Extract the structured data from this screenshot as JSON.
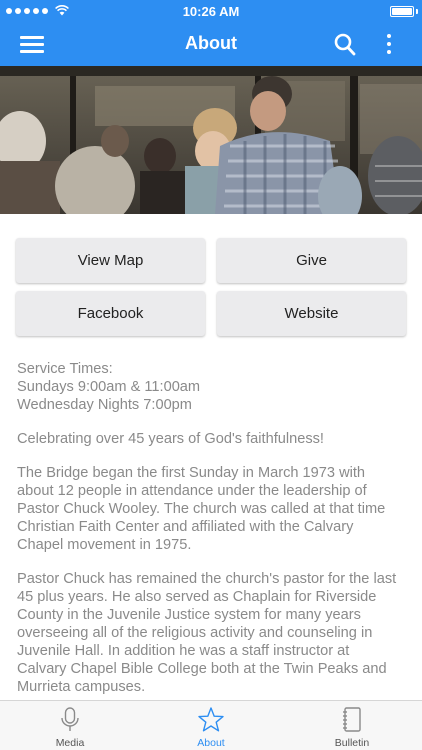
{
  "status_bar": {
    "time": "10:26 AM",
    "signal_dots": 5,
    "wifi_icon": "wifi-icon",
    "battery_icon": "battery-icon"
  },
  "nav": {
    "title": "About",
    "menu_icon": "hamburger-menu-icon",
    "search_icon": "search-icon",
    "more_icon": "vertical-ellipsis-icon",
    "accent_color": "#2d8ef2"
  },
  "hero": {
    "description_icon": "photo"
  },
  "buttons": {
    "view_map": "View Map",
    "give": "Give",
    "facebook": "Facebook",
    "website": "Website"
  },
  "content": {
    "service_heading": "Service Times:",
    "service_sunday": "Sundays 9:00am & 11:00am",
    "service_wednesday": "Wednesday Nights 7:00pm",
    "celebrating": "Celebrating over 45 years of God's faithfulness!",
    "para1": [
      "The Bridge began the first Sunday in March 1973 with",
      "about 12 people in attendance under the leadership of",
      "Pastor Chuck Wooley. The church was called at that time",
      "Christian Faith Center and affiliated with the Calvary",
      "Chapel movement in 1975."
    ],
    "para2": [
      "Pastor Chuck has remained the church's pastor for the last",
      "45 plus years. He also served as Chaplain for Riverside",
      "County in the Juvenile Justice system for many years",
      "overseeing all of the religious activity and counseling in",
      "Juvenile Hall. In addition he was a staff instructor at",
      "Calvary Chapel Bible College both at the Twin Peaks and",
      "Murrieta campuses."
    ]
  },
  "tabs": [
    {
      "label": "Media",
      "icon": "microphone-icon",
      "active": false
    },
    {
      "label": "About",
      "icon": "star-icon",
      "active": true
    },
    {
      "label": "Bulletin",
      "icon": "notebook-icon",
      "active": false
    }
  ]
}
